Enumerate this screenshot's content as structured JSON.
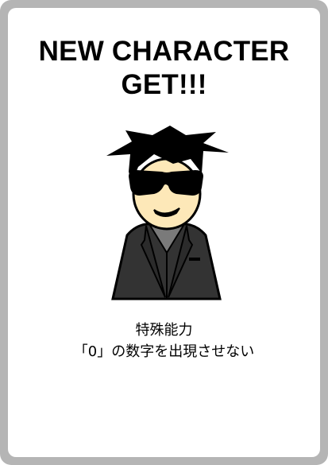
{
  "card": {
    "title_line1": "NEW CHARACTER",
    "title_line2": "GET!!!",
    "ability_heading": "特殊能力",
    "ability_text": "「0」の数字を出現させない"
  },
  "colors": {
    "frame": "#b5b5b5",
    "background": "#ffffff",
    "skin": "#fde8b8",
    "hair": "#000000",
    "suit": "#333333",
    "shirt": "#7a7a7a"
  },
  "icons": {
    "character": "man-in-black-icon"
  }
}
